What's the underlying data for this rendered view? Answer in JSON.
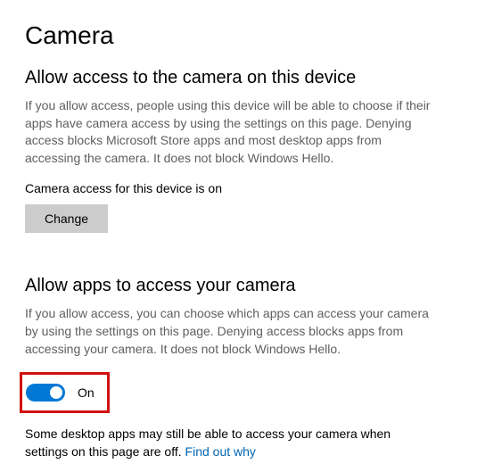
{
  "title": "Camera",
  "section1": {
    "heading": "Allow access to the camera on this device",
    "description": "If you allow access, people using this device will be able to choose if their apps have camera access by using the settings on this page. Denying access blocks Microsoft Store apps and most desktop apps from accessing the camera. It does not block Windows Hello.",
    "status": "Camera access for this device is on",
    "change_label": "Change"
  },
  "section2": {
    "heading": "Allow apps to access your camera",
    "description": "If you allow access, you can choose which apps can access your camera by using the settings on this page. Denying access blocks apps from accessing your camera. It does not block Windows Hello.",
    "toggle_state": "On"
  },
  "footer": {
    "text": "Some desktop apps may still be able to access your camera when settings on this page are off. ",
    "link": "Find out why"
  }
}
